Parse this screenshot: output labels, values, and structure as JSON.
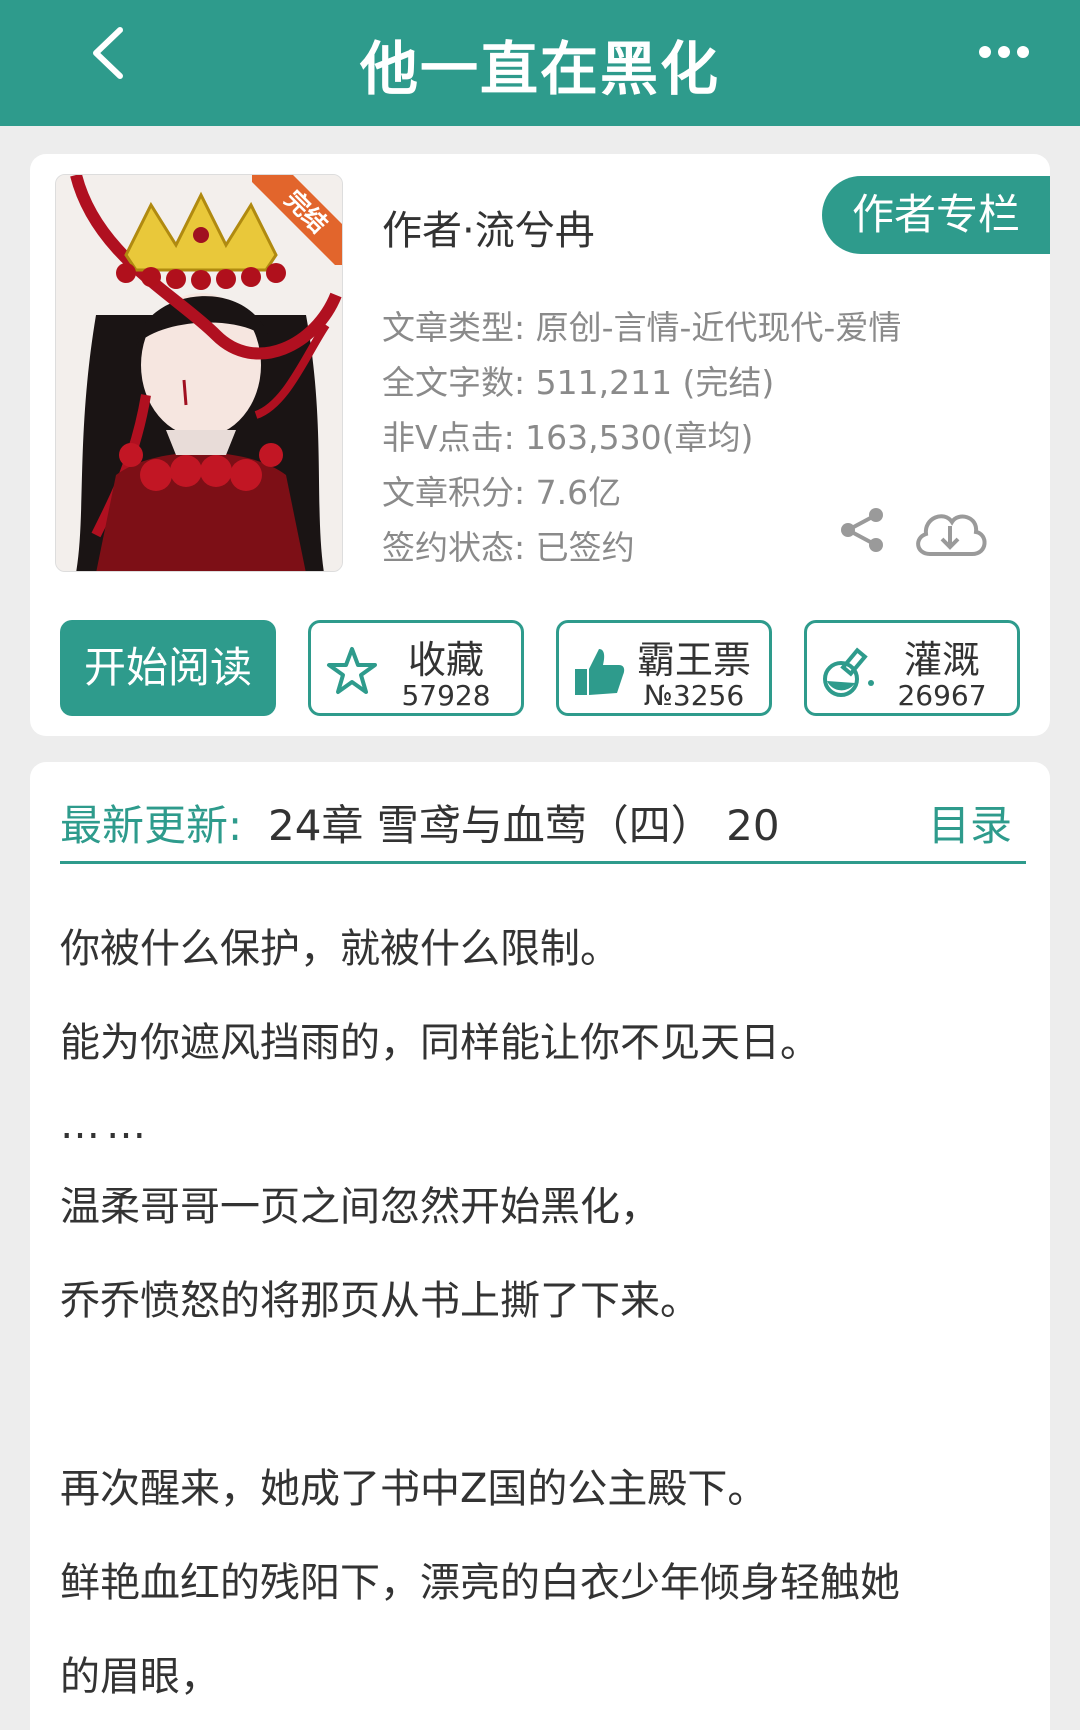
{
  "header": {
    "title": "他一直在黑化"
  },
  "book": {
    "badge": "完结",
    "author_line": "作者·流兮冉",
    "author_column_button": "作者专栏",
    "meta": [
      "文章类型: 原创-言情-近代现代-爱情",
      "全文字数: 511,211 (完结)",
      "非Ⅴ点击: 163,530(章均)",
      "文章积分: 7.6亿",
      "签约状态: 已签约"
    ]
  },
  "actions": {
    "read_button": "开始阅读",
    "favorite": {
      "label": "收藏",
      "count": "57928"
    },
    "ticket": {
      "label": "霸王票",
      "count": "№3256"
    },
    "water": {
      "label": "灌溉",
      "count": "26967"
    }
  },
  "update": {
    "label": "最新更新:",
    "text": "24章  雪鸢与血莺（四）  20",
    "toc": "目录"
  },
  "description": [
    "你被什么保护，就被什么限制。",
    "能为你遮风挡雨的，同样能让你不见天日。",
    "……",
    "温柔哥哥一页之间忽然开始黑化，",
    "乔乔愤怒的将那页从书上撕了下来。",
    "",
    "再次醒来，她成了书中Z国的公主殿下。",
    "鲜艳血红的残阳下，漂亮的白衣少年倾身轻触她",
    "的眉眼，"
  ],
  "colors": {
    "primary": "#2e9b8c",
    "badge": "#e2652c",
    "background": "#ededed"
  }
}
